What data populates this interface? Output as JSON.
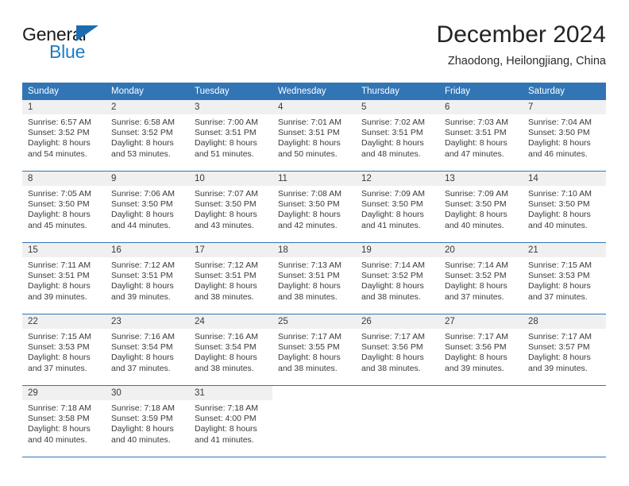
{
  "brand": {
    "name_top": "General",
    "name_bottom": "Blue",
    "triangle_color": "#1d6cb0",
    "blue_text_color": "#1d7cc4"
  },
  "header": {
    "title": "December 2024",
    "subtitle": "Zhaodong, Heilongjiang, China"
  },
  "theme": {
    "header_blue": "#3175b5",
    "daynum_band": "#f0f0f0",
    "text": "#3a3a3a"
  },
  "weekdays": [
    "Sunday",
    "Monday",
    "Tuesday",
    "Wednesday",
    "Thursday",
    "Friday",
    "Saturday"
  ],
  "weeks": [
    {
      "days": [
        {
          "num": "1",
          "sunrise": "Sunrise: 6:57 AM",
          "sunset": "Sunset: 3:52 PM",
          "daylight1": "Daylight: 8 hours",
          "daylight2": "and 54 minutes."
        },
        {
          "num": "2",
          "sunrise": "Sunrise: 6:58 AM",
          "sunset": "Sunset: 3:52 PM",
          "daylight1": "Daylight: 8 hours",
          "daylight2": "and 53 minutes."
        },
        {
          "num": "3",
          "sunrise": "Sunrise: 7:00 AM",
          "sunset": "Sunset: 3:51 PM",
          "daylight1": "Daylight: 8 hours",
          "daylight2": "and 51 minutes."
        },
        {
          "num": "4",
          "sunrise": "Sunrise: 7:01 AM",
          "sunset": "Sunset: 3:51 PM",
          "daylight1": "Daylight: 8 hours",
          "daylight2": "and 50 minutes."
        },
        {
          "num": "5",
          "sunrise": "Sunrise: 7:02 AM",
          "sunset": "Sunset: 3:51 PM",
          "daylight1": "Daylight: 8 hours",
          "daylight2": "and 48 minutes."
        },
        {
          "num": "6",
          "sunrise": "Sunrise: 7:03 AM",
          "sunset": "Sunset: 3:51 PM",
          "daylight1": "Daylight: 8 hours",
          "daylight2": "and 47 minutes."
        },
        {
          "num": "7",
          "sunrise": "Sunrise: 7:04 AM",
          "sunset": "Sunset: 3:50 PM",
          "daylight1": "Daylight: 8 hours",
          "daylight2": "and 46 minutes."
        }
      ]
    },
    {
      "days": [
        {
          "num": "8",
          "sunrise": "Sunrise: 7:05 AM",
          "sunset": "Sunset: 3:50 PM",
          "daylight1": "Daylight: 8 hours",
          "daylight2": "and 45 minutes."
        },
        {
          "num": "9",
          "sunrise": "Sunrise: 7:06 AM",
          "sunset": "Sunset: 3:50 PM",
          "daylight1": "Daylight: 8 hours",
          "daylight2": "and 44 minutes."
        },
        {
          "num": "10",
          "sunrise": "Sunrise: 7:07 AM",
          "sunset": "Sunset: 3:50 PM",
          "daylight1": "Daylight: 8 hours",
          "daylight2": "and 43 minutes."
        },
        {
          "num": "11",
          "sunrise": "Sunrise: 7:08 AM",
          "sunset": "Sunset: 3:50 PM",
          "daylight1": "Daylight: 8 hours",
          "daylight2": "and 42 minutes."
        },
        {
          "num": "12",
          "sunrise": "Sunrise: 7:09 AM",
          "sunset": "Sunset: 3:50 PM",
          "daylight1": "Daylight: 8 hours",
          "daylight2": "and 41 minutes."
        },
        {
          "num": "13",
          "sunrise": "Sunrise: 7:09 AM",
          "sunset": "Sunset: 3:50 PM",
          "daylight1": "Daylight: 8 hours",
          "daylight2": "and 40 minutes."
        },
        {
          "num": "14",
          "sunrise": "Sunrise: 7:10 AM",
          "sunset": "Sunset: 3:50 PM",
          "daylight1": "Daylight: 8 hours",
          "daylight2": "and 40 minutes."
        }
      ]
    },
    {
      "days": [
        {
          "num": "15",
          "sunrise": "Sunrise: 7:11 AM",
          "sunset": "Sunset: 3:51 PM",
          "daylight1": "Daylight: 8 hours",
          "daylight2": "and 39 minutes."
        },
        {
          "num": "16",
          "sunrise": "Sunrise: 7:12 AM",
          "sunset": "Sunset: 3:51 PM",
          "daylight1": "Daylight: 8 hours",
          "daylight2": "and 39 minutes."
        },
        {
          "num": "17",
          "sunrise": "Sunrise: 7:12 AM",
          "sunset": "Sunset: 3:51 PM",
          "daylight1": "Daylight: 8 hours",
          "daylight2": "and 38 minutes."
        },
        {
          "num": "18",
          "sunrise": "Sunrise: 7:13 AM",
          "sunset": "Sunset: 3:51 PM",
          "daylight1": "Daylight: 8 hours",
          "daylight2": "and 38 minutes."
        },
        {
          "num": "19",
          "sunrise": "Sunrise: 7:14 AM",
          "sunset": "Sunset: 3:52 PM",
          "daylight1": "Daylight: 8 hours",
          "daylight2": "and 38 minutes."
        },
        {
          "num": "20",
          "sunrise": "Sunrise: 7:14 AM",
          "sunset": "Sunset: 3:52 PM",
          "daylight1": "Daylight: 8 hours",
          "daylight2": "and 37 minutes."
        },
        {
          "num": "21",
          "sunrise": "Sunrise: 7:15 AM",
          "sunset": "Sunset: 3:53 PM",
          "daylight1": "Daylight: 8 hours",
          "daylight2": "and 37 minutes."
        }
      ]
    },
    {
      "days": [
        {
          "num": "22",
          "sunrise": "Sunrise: 7:15 AM",
          "sunset": "Sunset: 3:53 PM",
          "daylight1": "Daylight: 8 hours",
          "daylight2": "and 37 minutes."
        },
        {
          "num": "23",
          "sunrise": "Sunrise: 7:16 AM",
          "sunset": "Sunset: 3:54 PM",
          "daylight1": "Daylight: 8 hours",
          "daylight2": "and 37 minutes."
        },
        {
          "num": "24",
          "sunrise": "Sunrise: 7:16 AM",
          "sunset": "Sunset: 3:54 PM",
          "daylight1": "Daylight: 8 hours",
          "daylight2": "and 38 minutes."
        },
        {
          "num": "25",
          "sunrise": "Sunrise: 7:17 AM",
          "sunset": "Sunset: 3:55 PM",
          "daylight1": "Daylight: 8 hours",
          "daylight2": "and 38 minutes."
        },
        {
          "num": "26",
          "sunrise": "Sunrise: 7:17 AM",
          "sunset": "Sunset: 3:56 PM",
          "daylight1": "Daylight: 8 hours",
          "daylight2": "and 38 minutes."
        },
        {
          "num": "27",
          "sunrise": "Sunrise: 7:17 AM",
          "sunset": "Sunset: 3:56 PM",
          "daylight1": "Daylight: 8 hours",
          "daylight2": "and 39 minutes."
        },
        {
          "num": "28",
          "sunrise": "Sunrise: 7:17 AM",
          "sunset": "Sunset: 3:57 PM",
          "daylight1": "Daylight: 8 hours",
          "daylight2": "and 39 minutes."
        }
      ]
    },
    {
      "days": [
        {
          "num": "29",
          "sunrise": "Sunrise: 7:18 AM",
          "sunset": "Sunset: 3:58 PM",
          "daylight1": "Daylight: 8 hours",
          "daylight2": "and 40 minutes."
        },
        {
          "num": "30",
          "sunrise": "Sunrise: 7:18 AM",
          "sunset": "Sunset: 3:59 PM",
          "daylight1": "Daylight: 8 hours",
          "daylight2": "and 40 minutes."
        },
        {
          "num": "31",
          "sunrise": "Sunrise: 7:18 AM",
          "sunset": "Sunset: 4:00 PM",
          "daylight1": "Daylight: 8 hours",
          "daylight2": "and 41 minutes."
        },
        {
          "num": "",
          "sunrise": "",
          "sunset": "",
          "daylight1": "",
          "daylight2": ""
        },
        {
          "num": "",
          "sunrise": "",
          "sunset": "",
          "daylight1": "",
          "daylight2": ""
        },
        {
          "num": "",
          "sunrise": "",
          "sunset": "",
          "daylight1": "",
          "daylight2": ""
        },
        {
          "num": "",
          "sunrise": "",
          "sunset": "",
          "daylight1": "",
          "daylight2": ""
        }
      ]
    }
  ]
}
